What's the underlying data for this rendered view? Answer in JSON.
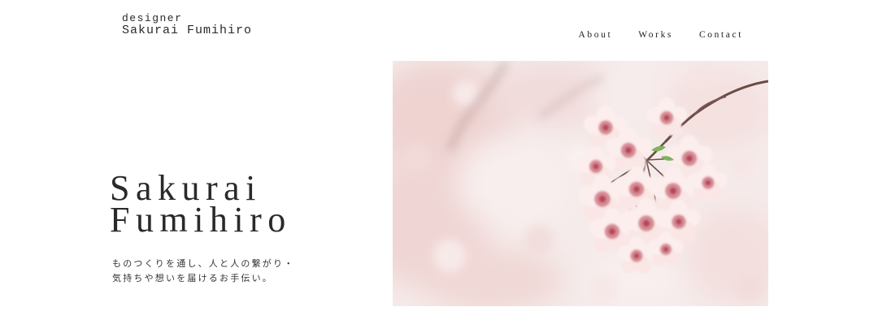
{
  "header": {
    "logo_sub": "designer",
    "logo_main": "Sakurai Fumihiro",
    "nav": [
      {
        "label": "About"
      },
      {
        "label": "Works"
      },
      {
        "label": "Contact"
      }
    ]
  },
  "hero": {
    "title_line1": "Sakurai",
    "title_line2": "Fumihiro",
    "tagline_line1": "ものつくりを通し、人と人の繋がり・",
    "tagline_line2": "気持ちや想いを届けるお手伝い。",
    "image_subject": "cherry-blossom-photo",
    "colors": {
      "petal": "#f7dbd9",
      "petal_center": "#c9707a",
      "background": "#f4e8e6"
    }
  }
}
